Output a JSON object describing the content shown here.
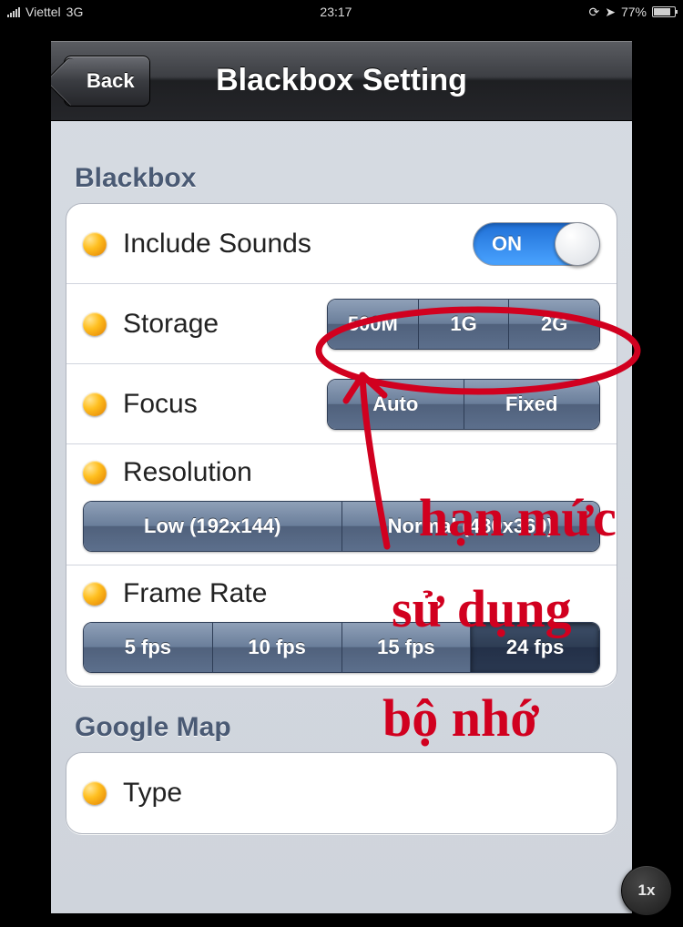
{
  "statusbar": {
    "carrier": "Viettel",
    "network": "3G",
    "time": "23:17",
    "battery_pct": "77%"
  },
  "navbar": {
    "back_label": "Back",
    "title": "Blackbox Setting"
  },
  "sections": {
    "blackbox_label": "Blackbox",
    "googlemap_label": "Google Map"
  },
  "rows": {
    "include_sounds": {
      "label": "Include Sounds",
      "switch": "ON"
    },
    "storage": {
      "label": "Storage",
      "options": [
        "500M",
        "1G",
        "2G"
      ]
    },
    "focus": {
      "label": "Focus",
      "options": [
        "Auto",
        "Fixed"
      ]
    },
    "resolution": {
      "label": "Resolution",
      "options": [
        "Low (192x144)",
        "Normal (480x360)"
      ]
    },
    "framerate": {
      "label": "Frame Rate",
      "options": [
        "5 fps",
        "10 fps",
        "15 fps",
        "24 fps"
      ],
      "selected": "24 fps"
    },
    "type": {
      "label": "Type"
    }
  },
  "zoom_indicator": "1x",
  "handwriting": {
    "line1": "hạn mức",
    "line2": "sử dụng",
    "line3": "bộ nhớ"
  }
}
